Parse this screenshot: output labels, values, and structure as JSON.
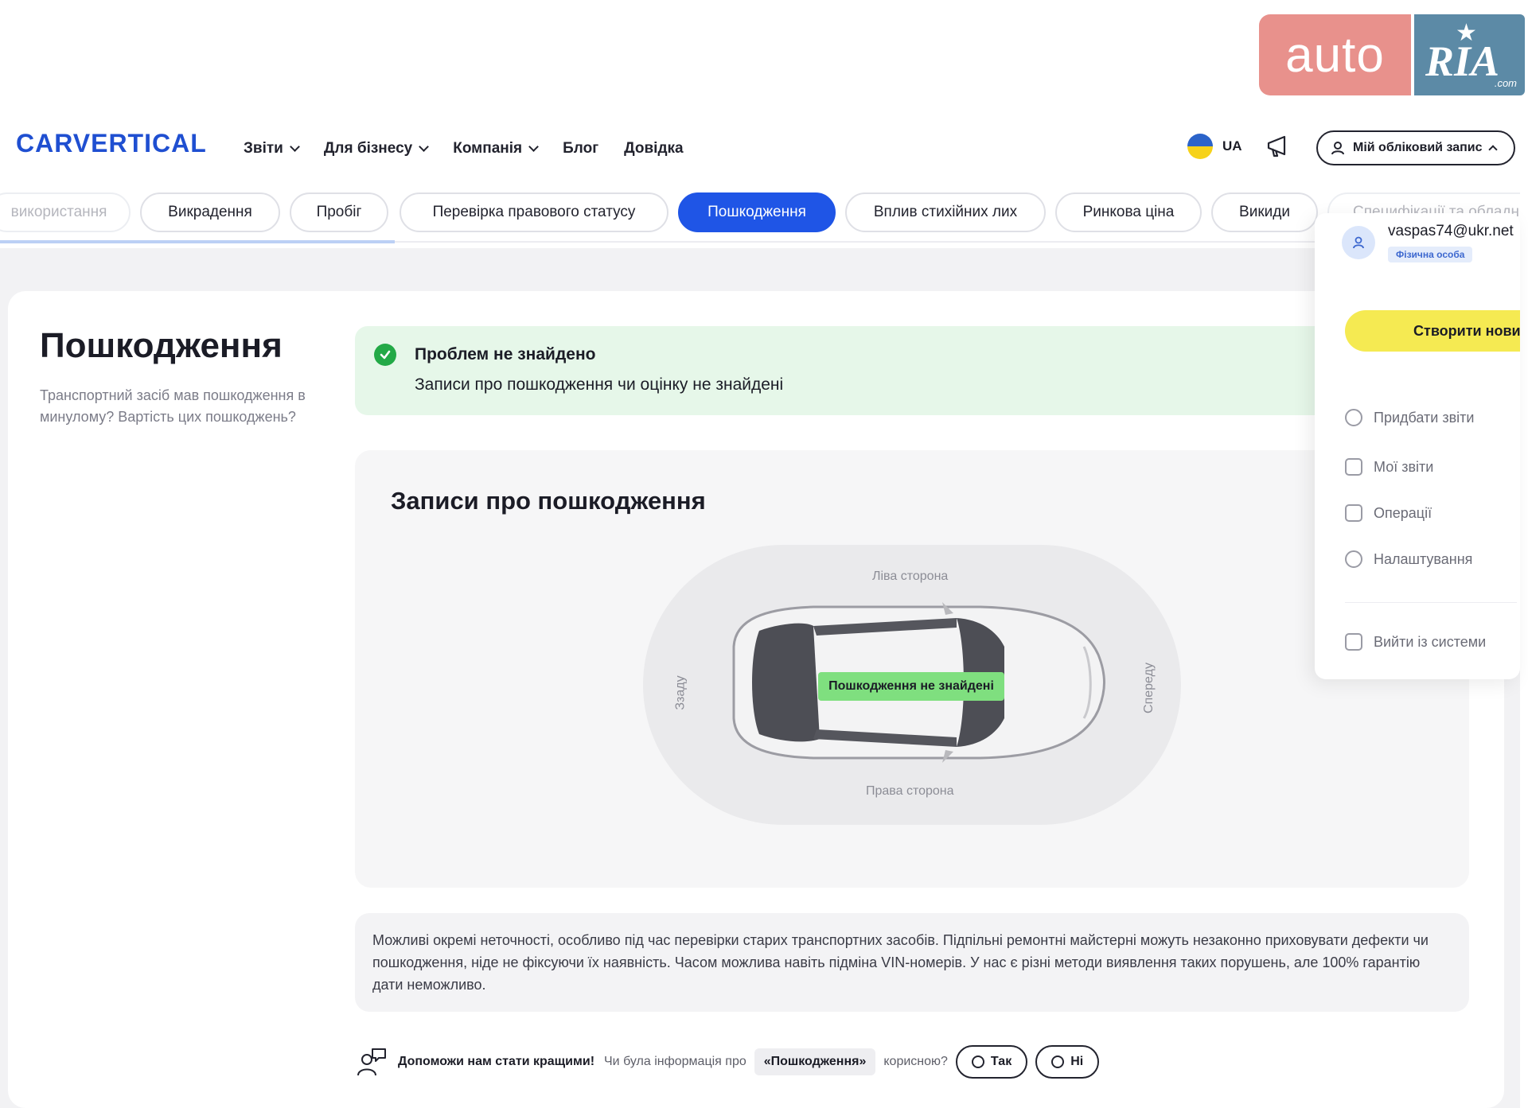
{
  "watermark": {
    "auto": "auto",
    "ria": "RIA",
    "com": ".com"
  },
  "header": {
    "logo": "CARVERTICAL",
    "nav": [
      "Звіти",
      "Для бізнесу",
      "Компанія",
      "Блог",
      "Довідка"
    ],
    "language": "UA",
    "account_button": "Мій обліковий запис"
  },
  "tabs": [
    {
      "label": "використання",
      "state": "faded"
    },
    {
      "label": "Викрадення",
      "state": "normal"
    },
    {
      "label": "Пробіг",
      "state": "normal"
    },
    {
      "label": "Перевірка правового статусу",
      "state": "normal"
    },
    {
      "label": "Пошкодження",
      "state": "active"
    },
    {
      "label": "Вплив стихійних лих",
      "state": "normal"
    },
    {
      "label": "Ринкова ціна",
      "state": "normal"
    },
    {
      "label": "Викиди",
      "state": "normal"
    },
    {
      "label": "Специфікації та обладн",
      "state": "faded"
    }
  ],
  "section": {
    "title": "Пошкодження",
    "description": "Транспортний засіб мав пошкодження в минулому? Вартість цих пошкоджень?"
  },
  "status": {
    "title": "Проблем не знайдено",
    "text": "Записи про пошкодження чи оцінку не знайдені"
  },
  "records": {
    "title": "Записи про пошкодження",
    "left_side": "Ліва сторона",
    "right_side": "Права сторона",
    "rear": "Ззаду",
    "front": "Спереду",
    "badge": "Пошкодження не знайдені"
  },
  "disclaimer": "Можливі окремі неточності, особливо під час перевірки старих транспортних засобів. Підпільні ремонтні майстерні можуть незаконно приховувати дефекти чи пошкодження, ніде не фіксуючи їх наявність. Часом можлива навіть підміна VIN-номерів. У нас є різні методи виявлення таких порушень, але 100% гарантію дати неможливо.",
  "feedback": {
    "prompt": "Допоможи нам стати кращими!",
    "question_start": "Чи була інформація про",
    "topic": "«Пошкодження»",
    "question_end": "корисною?",
    "yes": "Так",
    "no": "Ні"
  },
  "account_menu": {
    "email": "vaspas74@ukr.net",
    "badge": "Фізична особа",
    "create_button": "Створити новий",
    "items": [
      "Придбати звіти",
      "Мої звіти",
      "Операції",
      "Налаштування"
    ],
    "logout": "Вийти із системи"
  },
  "colors": {
    "brand": "#1f4fd1",
    "active_tab": "#1f55e6",
    "success": "#23a947",
    "create": "#f5ea52"
  }
}
